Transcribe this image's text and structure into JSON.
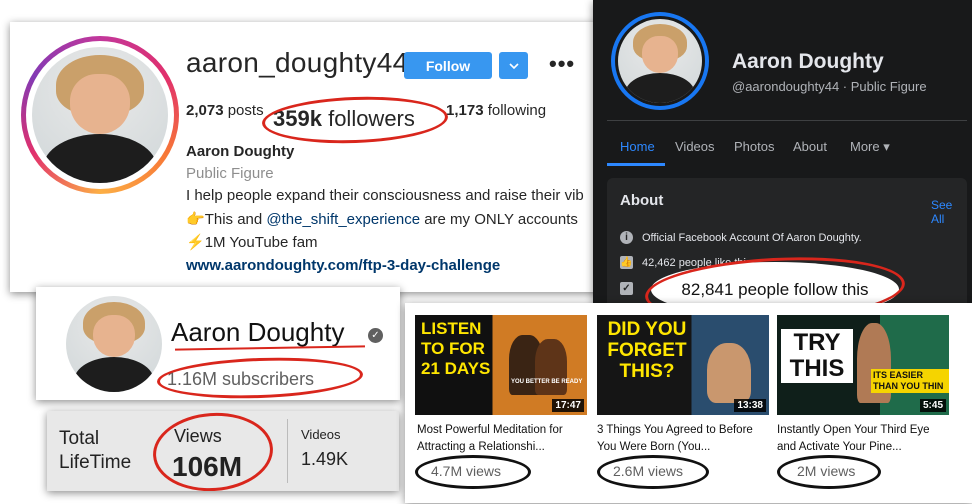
{
  "instagram": {
    "username": "aaron_doughty44",
    "follow_label": "Follow",
    "dropdown_icon": "chevron-down-icon",
    "more_icon": "more-horizontal-icon",
    "posts_count": "2,073",
    "posts_label": "posts",
    "followers_count": "359k",
    "followers_label": "followers",
    "following_count": "1,173",
    "following_label": "following",
    "name": "Aaron Doughty",
    "category": "Public Figure",
    "bio_line1": "I help people expand their consciousness and raise their vib",
    "bio_line2_emoji": "👉",
    "bio_line2_pre": "This and ",
    "bio_line2_mention": "@the_shift_experience",
    "bio_line2_post": " are my ONLY accounts",
    "bio_line3_emoji": "⚡",
    "bio_line3": "1M YouTube fam",
    "link": "www.aarondoughty.com/ftp-3-day-challenge"
  },
  "facebook": {
    "name": "Aaron Doughty",
    "subtitle": "@aarondoughty44 · Public Figure",
    "tabs": [
      "Home",
      "Videos",
      "Photos",
      "About",
      "More ▾"
    ],
    "about_title": "About",
    "see_all": "See All",
    "about_row1": "Official Facebook Account Of Aaron Doughty.",
    "about_row2": "42,462 people like this",
    "follow_count": "82,841 people follow this"
  },
  "youtube_channel": {
    "name": "Aaron Doughty",
    "verified_icon": "verified-check-icon",
    "subscribers": "1.16M subscribers"
  },
  "youtube_stats": {
    "total_label": "Total LifeTime",
    "views_label": "Views",
    "views_value": "106M",
    "videos_label": "Videos",
    "videos_value": "1.49K"
  },
  "youtube_videos": [
    {
      "thumb_text": "LISTEN TO FOR 21 DAYS",
      "thumb_sub": "YOU BETTER BE READY",
      "duration": "17:47",
      "title": "Most Powerful Meditation for Attracting a Relationshi...",
      "views": "4.7M views"
    },
    {
      "thumb_text": "DID YOU FORGET THIS?",
      "duration": "13:38",
      "title": "3 Things You Agreed to Before You Were Born (You...",
      "views": "2.6M views"
    },
    {
      "thumb_text": "TRY THIS",
      "thumb_sub": "ITS EASIER THAN YOU THIN",
      "duration": "5:45",
      "title": "Instantly Open Your Third Eye and Activate Your Pine...",
      "views": "2M views"
    }
  ]
}
